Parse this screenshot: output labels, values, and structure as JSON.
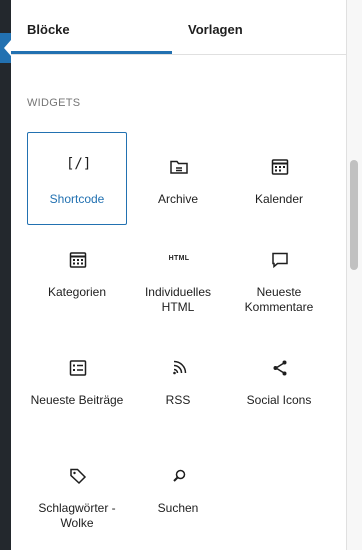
{
  "tabs": {
    "blocks": "Blöcke",
    "patterns": "Vorlagen"
  },
  "section": {
    "title": "WIDGETS"
  },
  "blocks": [
    {
      "label": "Shortcode",
      "icon": "shortcode-icon",
      "selected": true
    },
    {
      "label": "Archive",
      "icon": "folder-icon"
    },
    {
      "label": "Kalender",
      "icon": "calendar-icon"
    },
    {
      "label": "Kategorien",
      "icon": "categories-icon"
    },
    {
      "label": "Individuelles HTML",
      "icon": "html-icon",
      "icon_text": "HTML"
    },
    {
      "label": "Neueste Kommentare",
      "icon": "comment-icon"
    },
    {
      "label": "Neueste Beiträge",
      "icon": "post-list-icon"
    },
    {
      "label": "RSS",
      "icon": "rss-icon"
    },
    {
      "label": "Social Icons",
      "icon": "share-icon"
    },
    {
      "label": "Schlagwörter -Wolke",
      "icon": "tag-icon"
    },
    {
      "label": "Suchen",
      "icon": "search-icon"
    }
  ],
  "colors": {
    "accent": "#2271b1",
    "admin_bar": "#23282d",
    "muted_text": "#757575"
  }
}
